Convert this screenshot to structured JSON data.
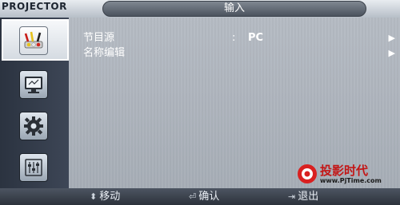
{
  "header": {
    "brand": "PROJECTOR",
    "title": "输入"
  },
  "sidebar": {
    "items": [
      {
        "name": "input",
        "icon": "plug-cables-icon",
        "active": true
      },
      {
        "name": "picture",
        "icon": "monitor-icon",
        "active": false
      },
      {
        "name": "setup",
        "icon": "gear-icon",
        "active": false
      },
      {
        "name": "option",
        "icon": "sliders-icon",
        "active": false
      }
    ]
  },
  "menu": {
    "items": [
      {
        "label": "节目源",
        "separator": ":",
        "value": "PC",
        "arrow": "▶"
      },
      {
        "label": "名称编辑",
        "separator": "",
        "value": "",
        "arrow": "▶"
      }
    ]
  },
  "footer": {
    "move_label": "移动",
    "enter_label": "确认",
    "exit_label": "退出"
  },
  "watermark": {
    "text": "投影时代",
    "url": "www.PjTime.com"
  },
  "colors": {
    "panel": "#aeb4bc",
    "sidebar": "#323a47",
    "accent_red": "#c31616"
  }
}
